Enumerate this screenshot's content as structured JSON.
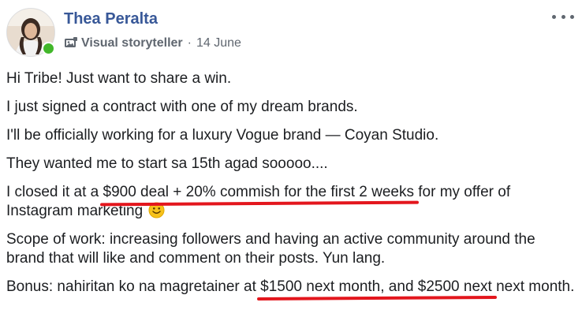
{
  "post": {
    "author": "Thea Peralta",
    "badge_icon": "storyteller-badge-icon",
    "badge_label": "Visual storyteller",
    "separator": "·",
    "date": "14 June",
    "more_icon": "more-options-icon",
    "online_color": "#42b72a",
    "name_color": "#385898",
    "highlight_color": "#e3161d",
    "paragraphs": {
      "p1": "Hi Tribe! Just want to share a win.",
      "p2": "I just signed a contract with one of my dream brands.",
      "p3": "I'll be officially working for a luxury Vogue brand — Coyan Studio.",
      "p4": "They wanted me to start sa 15th agad sooooo....",
      "p5_before": "I closed it at a ",
      "p5_highlight": "$900 deal + 20% commish for the first 2 weeks",
      "p5_after": " for my offer of Instagram marketing ",
      "p6": "Scope of work: increasing followers and having an active community around the brand that will like and comment on their posts. Yun lang.",
      "p7_before": "Bonus: nahiritan ko na magretainer at ",
      "p7_highlight": "$1500 next month, and $2500 next",
      "p7_after": " next month."
    },
    "emoji_icon": "smiley-emoji-icon"
  }
}
